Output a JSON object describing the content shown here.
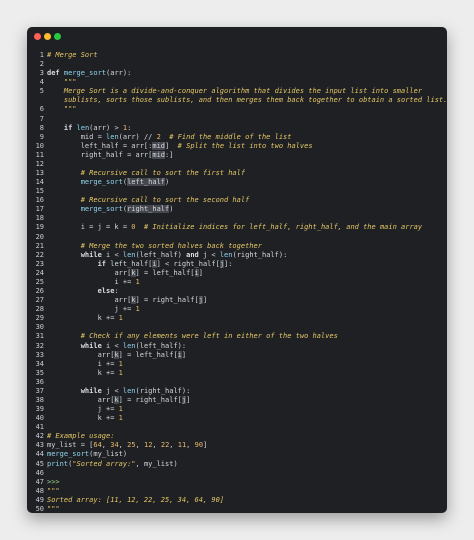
{
  "window": {
    "controls": [
      "close",
      "minimize",
      "maximize"
    ]
  },
  "lines": [
    "1",
    "2",
    "3",
    "4",
    "5",
    "6",
    "7",
    "8",
    "9",
    "10",
    "11",
    "12",
    "13",
    "14",
    "15",
    "16",
    "17",
    "18",
    "19",
    "20",
    "21",
    "22",
    "23",
    "24",
    "25",
    "26",
    "27",
    "28",
    "29",
    "30",
    "31",
    "32",
    "33",
    "34",
    "35",
    "36",
    "37",
    "38",
    "39",
    "40",
    "41",
    "42",
    "43",
    "44",
    "45",
    "46",
    "47",
    "48",
    "49",
    "50"
  ],
  "code": {
    "l1": "# Merge Sort",
    "l3_kw": "def",
    "l3_fn": "merge_sort",
    "l3_rest": "(arr):",
    "l4": "\"\"\"",
    "l5a": "Merge Sort is a divide-and-conquer algorithm that divides the input list into smaller",
    "l5b": "sublists, sorts those sublists, and then merges them back together to obtain a sorted list.",
    "l6": "\"\"\"",
    "l8_kw": "if",
    "l8_fn": "len",
    "l8_a": "(",
    "l8_arr": "arr",
    "l8_b": ") > ",
    "l8_n": "1",
    "l8_c": ":",
    "l9_a": "mid = ",
    "l9_fn": "len",
    "l9_b": "(arr) // ",
    "l9_n": "2",
    "l9_c": "  # Find the middle of the list",
    "l10_a": "left_half = arr[:",
    "l10_i": "mid",
    "l10_b": "]",
    "l10_c": "  # Split the list into two halves",
    "l11_a": "right_half = arr[",
    "l11_i": "mid",
    "l11_b": ":]",
    "l13": "# Recursive call to sort the first half",
    "l14_fn": "merge_sort",
    "l14_a": "(",
    "l14_i": "left_half",
    "l14_b": ")",
    "l16": "# Recursive call to sort the second half",
    "l17_fn": "merge_sort",
    "l17_a": "(",
    "l17_i": "right_half",
    "l17_b": ")",
    "l19_a": "i = j = k = ",
    "l19_n": "0",
    "l19_c": "  # Initialize indices for left_half, right_half, and the main array",
    "l21": "# Merge the two sorted halves back together",
    "l22_kw": "while",
    "l22_a": " i < ",
    "l22_fn1": "len",
    "l22_b": "(left_half) ",
    "l22_and": "and",
    "l22_c": " j < ",
    "l22_fn2": "len",
    "l22_d": "(right_half):",
    "l23_kw": "if",
    "l23_a": " left_half[",
    "l23_i1": "i",
    "l23_b": "] < right_half[",
    "l23_i2": "j",
    "l23_c": "]:",
    "l24_a": "arr[",
    "l24_i1": "k",
    "l24_b": "] = left_half[",
    "l24_i2": "i",
    "l24_c": "]",
    "l25_a": "i += ",
    "l25_n": "1",
    "l26_kw": "else",
    "l26_a": ":",
    "l27_a": "arr[",
    "l27_i1": "k",
    "l27_b": "] = right_half[",
    "l27_i2": "j",
    "l27_c": "]",
    "l28_a": "j += ",
    "l28_n": "1",
    "l29_a": "k += ",
    "l29_n": "1",
    "l31": "# Check if any elements were left in either of the two halves",
    "l32_kw": "while",
    "l32_a": " i < ",
    "l32_fn": "len",
    "l32_b": "(left_half):",
    "l33_a": "arr[",
    "l33_i1": "k",
    "l33_b": "] = left_half[",
    "l33_i2": "i",
    "l33_c": "]",
    "l34_a": "i += ",
    "l34_n": "1",
    "l35_a": "k += ",
    "l35_n": "1",
    "l37_kw": "while",
    "l37_a": " j < ",
    "l37_fn": "len",
    "l37_b": "(right_half):",
    "l38_a": "arr[",
    "l38_i1": "k",
    "l38_b": "] = right_half[",
    "l38_i2": "j",
    "l38_c": "]",
    "l39_a": "j += ",
    "l39_n": "1",
    "l40_a": "k += ",
    "l40_n": "1",
    "l42": "# Example usage:",
    "l43_a": "my_list = [",
    "l43_n1": "64",
    "l43_n2": "34",
    "l43_n3": "25",
    "l43_n4": "12",
    "l43_n5": "22",
    "l43_n6": "11",
    "l43_n7": "90",
    "l43_sep": ", ",
    "l43_b": "]",
    "l44_fn": "merge_sort",
    "l44_a": "(my_list)",
    "l45_fn": "print",
    "l45_a": "(",
    "l45_s": "\"Sorted array:\"",
    "l45_b": ", my_list)",
    "l47": ">>>",
    "l48": "\"\"\"",
    "l49": "Sorted array: [11, 12, 22, 25, 34, 64, 90]",
    "l50": "\"\"\""
  }
}
